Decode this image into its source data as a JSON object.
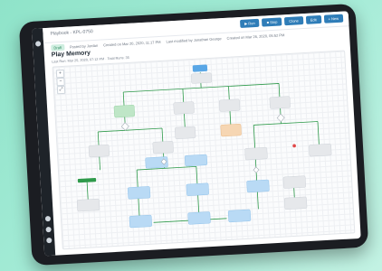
{
  "topbar": {
    "breadcrumb": "Playbook - KPL-0750",
    "buttons": [
      "▶ Run",
      "■ Stop",
      "Clone",
      "Edit",
      "+ New"
    ]
  },
  "meta": {
    "badge": "Draft",
    "created_by": "Posted by Jordan",
    "created_on": "Created on Mar 20, 2020, 11:17 PM",
    "modified_by": "Last modified by Jonathan George",
    "modified_on": "Created on Mar 26, 2020, 05:52 PM"
  },
  "playbook": {
    "title": "Play Memory",
    "subtitle": "Last Run: Mar 25, 2020, 07:12 PM  ·  Total Runs: 35"
  },
  "zoom_controls": [
    "+",
    "−",
    "⤢"
  ],
  "colors": {
    "sidebar": "#1e2329",
    "accent_blue": "#2f7db8",
    "node_green": "#bfe6c7",
    "node_blue": "#b9daf5",
    "node_orange": "#f6d6b3",
    "node_gray": "#e6e8eb",
    "edge_green": "#2f9a4b",
    "start_blue": "#5aa7e6"
  }
}
